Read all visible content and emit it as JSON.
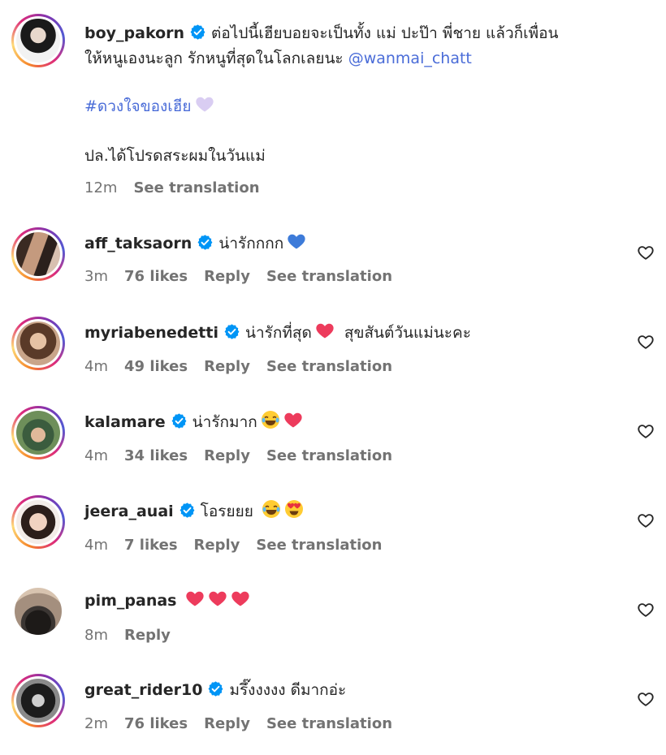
{
  "caption": {
    "username": "boy_pakorn",
    "text_line1": "ต่อไปนี้เฮียบอยจะเป็นทั้ง แม่ ปะป๊า พี่ชาย แล้วก็เพื่อน",
    "text_line2": "ให้หนูเองนะลูก รักหนูที่สุดในโลกเลยนะ",
    "mention": "@wanmai_chatt",
    "hashtag": "#ดวงใจของเฮีย",
    "ps": "ปล.ได้โปรดสระผมในวันแม่",
    "time": "12m",
    "see_translation": "See translation"
  },
  "comments": [
    {
      "username": "aff_taksaorn",
      "verified": true,
      "text": "น่ารักกกก",
      "time": "3m",
      "likes": "76 likes",
      "reply": "Reply",
      "see_translation": "See translation"
    },
    {
      "username": "myriabenedetti",
      "verified": true,
      "text": "น่ารักที่สุด",
      "text2": "สุขสันต์วันแม่นะคะ",
      "time": "4m",
      "likes": "49 likes",
      "reply": "Reply",
      "see_translation": "See translation"
    },
    {
      "username": "kalamare",
      "verified": true,
      "text": "น่ารักมาก",
      "time": "4m",
      "likes": "34 likes",
      "reply": "Reply",
      "see_translation": "See translation"
    },
    {
      "username": "jeera_auai",
      "verified": true,
      "text": "โอรยยย",
      "time": "4m",
      "likes": "7 likes",
      "reply": "Reply",
      "see_translation": "See translation"
    },
    {
      "username": "pim_panas",
      "verified": false,
      "text": "",
      "time": "8m",
      "reply": "Reply"
    },
    {
      "username": "great_rider10",
      "verified": true,
      "text": "มรึ๊งงงงง ดีมากอ่ะ",
      "time": "2m",
      "likes": "76 likes",
      "reply": "Reply",
      "see_translation": "See translation"
    }
  ],
  "icons": {
    "verified": "verified-badge-icon",
    "like": "heart-outline-icon"
  },
  "colors": {
    "verified": "#0095f6",
    "link": "#4a6cd8",
    "meta": "#737373",
    "heart": "#ed3b5c"
  }
}
